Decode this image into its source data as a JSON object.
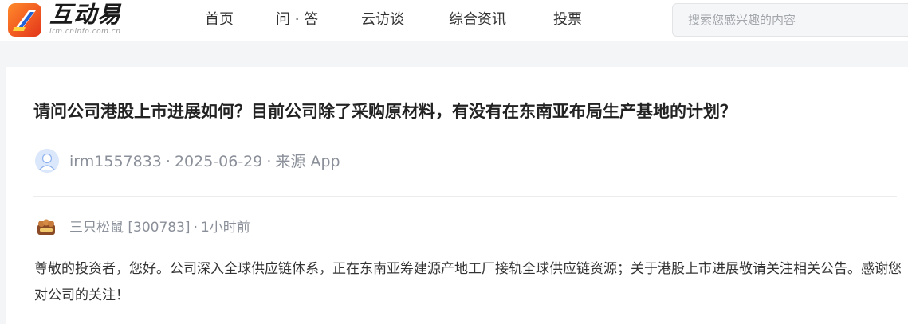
{
  "header": {
    "logo_text": "互动易",
    "logo_sub": "irm.cninfo.com.cn",
    "nav": [
      "首页",
      "问 · 答",
      "云访谈",
      "综合资讯",
      "投票"
    ],
    "search_placeholder": "搜索您感兴趣的内容"
  },
  "question": {
    "title": "请问公司港股上市进展如何？目前公司除了采购原材料，有没有在东南亚布局生产基地的计划？",
    "user": "irm1557833",
    "date": "2025-06-29",
    "source": "来源 App",
    "separator": "·"
  },
  "answer": {
    "company": "三只松鼠 [300783]",
    "time": "1小时前",
    "text": "尊敬的投资者，您好。公司深入全球供应链体系，正在东南亚筹建源产地工厂接轨全球供应链资源；关于港股上市进展敬请关注相关公告。感谢您对公司的关注！"
  },
  "icons": {
    "logo": "app-logo-icon",
    "asker_avatar": "user-avatar-icon",
    "company_logo": "company-logo-icon"
  },
  "colors": {
    "logo_orange": "#f15a22",
    "logo_blue": "#1f62d6",
    "meta_gray": "#8a8f99",
    "page_bg": "#f4f5f7"
  }
}
